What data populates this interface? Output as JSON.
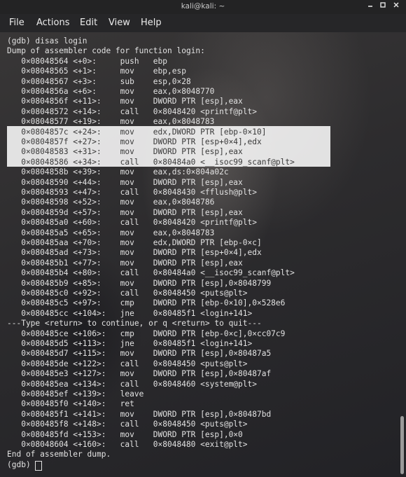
{
  "window": {
    "title": "kali@kali: ~",
    "buttons": [
      {
        "name": "minimize",
        "icon": "minimize-icon"
      },
      {
        "name": "maximize",
        "icon": "maximize-icon"
      },
      {
        "name": "close",
        "icon": "close-icon"
      }
    ]
  },
  "menu": [
    "File",
    "Actions",
    "Edit",
    "View",
    "Help"
  ],
  "terminal": {
    "lines": [
      "(gdb) disas login",
      "Dump of assembler code for function login:",
      "   0×08048564 <+0>:     push   ebp",
      "   0×08048565 <+1>:     mov    ebp,esp",
      "   0×08048567 <+3>:     sub    esp,0×28",
      "   0×0804856a <+6>:     mov    eax,0×8048770",
      "   0×0804856f <+11>:    mov    DWORD PTR [esp],eax",
      "   0×08048572 <+14>:    call   0×8048420 <printf@plt>",
      "   0×08048577 <+19>:    mov    eax,0×8048783",
      "   0×0804857c <+24>:    mov    edx,DWORD PTR [ebp-0×10]",
      "   0×0804857f <+27>:    mov    DWORD PTR [esp+0×4],edx",
      "   0×08048583 <+31>:    mov    DWORD PTR [esp],eax",
      "   0×08048586 <+34>:    call   0×80484a0 <__isoc99_scanf@plt>",
      "   0×0804858b <+39>:    mov    eax,ds:0×804a02c",
      "   0×08048590 <+44>:    mov    DWORD PTR [esp],eax",
      "   0×08048593 <+47>:    call   0×8048430 <fflush@plt>",
      "   0×08048598 <+52>:    mov    eax,0×8048786",
      "   0×0804859d <+57>:    mov    DWORD PTR [esp],eax",
      "   0×080485a0 <+60>:    call   0×8048420 <printf@plt>",
      "   0×080485a5 <+65>:    mov    eax,0×8048783",
      "   0×080485aa <+70>:    mov    edx,DWORD PTR [ebp-0×c]",
      "   0×080485ad <+73>:    mov    DWORD PTR [esp+0×4],edx",
      "   0×080485b1 <+77>:    mov    DWORD PTR [esp],eax",
      "   0×080485b4 <+80>:    call   0×80484a0 <__isoc99_scanf@plt>",
      "   0×080485b9 <+85>:    mov    DWORD PTR [esp],0×8048799",
      "   0×080485c0 <+92>:    call   0×8048450 <puts@plt>",
      "   0×080485c5 <+97>:    cmp    DWORD PTR [ebp-0×10],0×528e6",
      "   0×080485cc <+104>:   jne    0×80485f1 <login+141>",
      "---Type <return> to continue, or q <return> to quit---",
      "   0×080485ce <+106>:   cmp    DWORD PTR [ebp-0×c],0×cc07c9",
      "   0×080485d5 <+113>:   jne    0×80485f1 <login+141>",
      "   0×080485d7 <+115>:   mov    DWORD PTR [esp],0×80487a5",
      "   0×080485de <+122>:   call   0×8048450 <puts@plt>",
      "   0×080485e3 <+127>:   mov    DWORD PTR [esp],0×80487af",
      "   0×080485ea <+134>:   call   0×8048460 <system@plt>",
      "   0×080485ef <+139>:   leave",
      "   0×080485f0 <+140>:   ret",
      "   0×080485f1 <+141>:   mov    DWORD PTR [esp],0×80487bd",
      "   0×080485f8 <+148>:   call   0×8048450 <puts@plt>",
      "   0×080485fd <+153>:   mov    DWORD PTR [esp],0×0",
      "   0×08048604 <+160>:   call   0×8048480 <exit@plt>",
      "End of assembler dump.",
      "(gdb) "
    ],
    "selected_line_indices": [
      9,
      10,
      11,
      12
    ],
    "colors": {
      "text": "#e2e2e2",
      "selection_bg": "#ececec",
      "selection_text": "#3a3a3a"
    }
  },
  "scrollbar": {
    "thumb_fraction": 0.14,
    "position": 1.0
  }
}
